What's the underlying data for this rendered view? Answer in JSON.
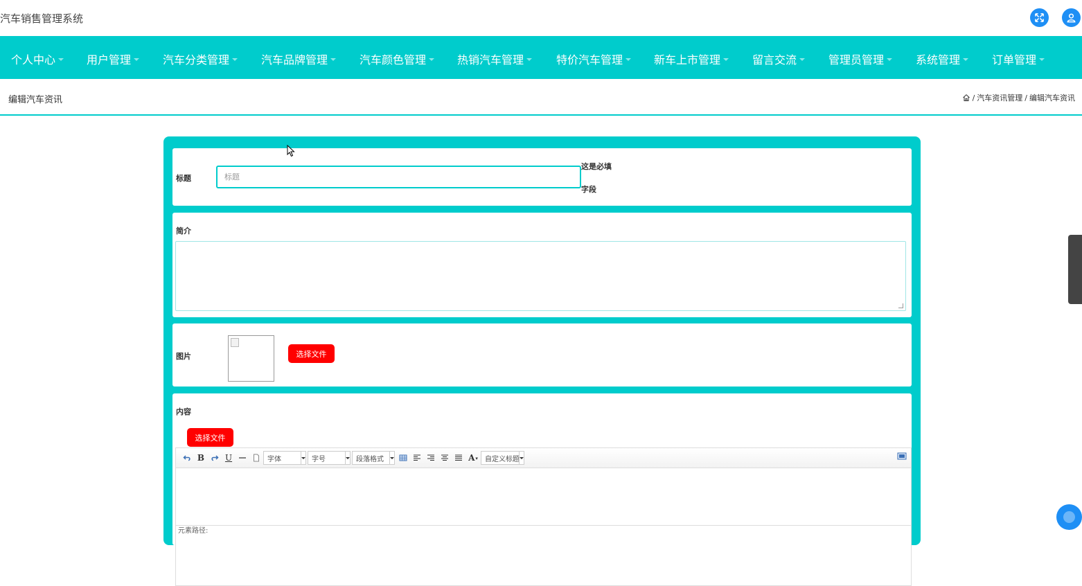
{
  "header": {
    "app_title": "汽车销售管理系统",
    "icons": [
      "fullscreen-icon",
      "user-icon"
    ],
    "accent_color": "#1e8ff5"
  },
  "nav": {
    "bg_color": "#00cccc",
    "items": [
      {
        "label": "个人中心"
      },
      {
        "label": "用户管理"
      },
      {
        "label": "汽车分类管理"
      },
      {
        "label": "汽车品牌管理"
      },
      {
        "label": "汽车颜色管理"
      },
      {
        "label": "热销汽车管理"
      },
      {
        "label": "特价汽车管理"
      },
      {
        "label": "新车上市管理"
      },
      {
        "label": "留言交流"
      },
      {
        "label": "管理员管理"
      },
      {
        "label": "系统管理"
      },
      {
        "label": "订单管理"
      }
    ]
  },
  "breadcrumb": {
    "page_title": "编辑汽车资讯",
    "home_icon": "home-icon",
    "sep": "/",
    "level1": "汽车资讯管理",
    "level2": "编辑汽车资讯"
  },
  "form": {
    "title_field": {
      "label": "标题",
      "placeholder": "标题",
      "value": "",
      "required_line1": "这是必填",
      "required_line2": "字段"
    },
    "intro_field": {
      "label": "简介",
      "value": ""
    },
    "image_field": {
      "label": "图片",
      "button_label": "选择文件"
    },
    "content_field": {
      "label": "内容",
      "upload_button_label": "选择文件",
      "toolbar": {
        "font_family": "字体",
        "font_size": "字号",
        "paragraph": "段落格式",
        "custom_heading": "自定义标题",
        "bold": "B",
        "underline": "U",
        "font_color": "A"
      },
      "status_text": "元素路径:"
    },
    "button_color": "#ff0000"
  }
}
